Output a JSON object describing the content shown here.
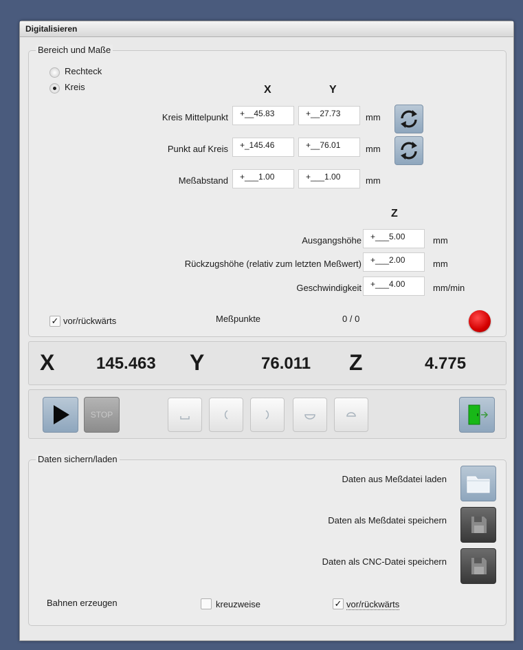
{
  "window": {
    "title": "Digitalisieren"
  },
  "area_group": {
    "title": "Bereich und Maße",
    "shape_options": [
      {
        "label": "Rechteck",
        "selected": false
      },
      {
        "label": "Kreis",
        "selected": true
      }
    ],
    "col_x": "X",
    "col_y": "Y",
    "col_z": "Z",
    "rows_xy": [
      {
        "label": "Kreis Mittelpunkt",
        "x": "+__45.83",
        "y": "+__27.73",
        "unit": "mm",
        "has_button": true
      },
      {
        "label": "Punkt auf Kreis",
        "x": "+_145.46",
        "y": "+__76.01",
        "unit": "mm",
        "has_button": true
      },
      {
        "label": "Meßabstand",
        "x": "+___1.00",
        "y": "+___1.00",
        "unit": "mm",
        "has_button": false
      }
    ],
    "rows_z": [
      {
        "label": "Ausgangshöhe",
        "value": "+___5.00",
        "unit": "mm"
      },
      {
        "label": "Rückzugshöhe (relativ zum letzten Meßwert)",
        "value": "+___2.00",
        "unit": "mm"
      },
      {
        "label": "Geschwindigkeit",
        "value": "+___4.00",
        "unit": "mm/min"
      }
    ],
    "direction_checkbox": {
      "label": "vor/rückwärts",
      "checked": true
    },
    "points_label": "Meßpunkte",
    "points_value": "0 / 0",
    "status_color": "#e00000"
  },
  "position": {
    "x_label": "X",
    "x_value": "145.463",
    "y_label": "Y",
    "y_value": "76.011",
    "z_label": "Z",
    "z_value": "4.775"
  },
  "toolbar": {
    "stop_label": "STOP"
  },
  "data_group": {
    "title": "Daten sichern/laden",
    "actions": [
      {
        "label": "Daten aus Meßdatei laden"
      },
      {
        "label": "Daten als Meßdatei speichern"
      },
      {
        "label": "Daten als CNC-Datei speichern"
      }
    ],
    "paths_label": "Bahnen erzeugen",
    "crosswise": {
      "label": "kreuzweise",
      "checked": false
    },
    "back_forth": {
      "label": "vor/rückwärts",
      "checked": true
    }
  },
  "colors": {
    "accent_button": "#9fb4c8",
    "background": "#4a5b7d"
  }
}
